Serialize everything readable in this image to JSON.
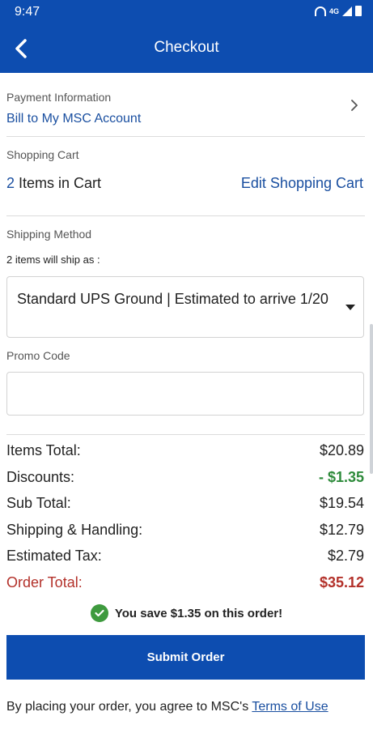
{
  "status_bar": {
    "time": "9:47",
    "network_label": "4G"
  },
  "app_bar": {
    "title": "Checkout"
  },
  "payment": {
    "section_label": "Payment Information",
    "value": "Bill to My MSC Account"
  },
  "cart": {
    "section_label": "Shopping Cart",
    "count": "2",
    "count_suffix": "Items in Cart",
    "edit_label": "Edit Shopping Cart"
  },
  "shipping": {
    "section_label": "Shipping Method",
    "note": "2 items will ship as :",
    "selected_option": "Standard UPS Ground | Estimated to arrive 1/20"
  },
  "promo": {
    "section_label": "Promo Code",
    "value": "",
    "placeholder": ""
  },
  "totals": {
    "items_total_label": "Items Total:",
    "items_total_value": "$20.89",
    "discounts_label": "Discounts:",
    "discounts_value": "- $1.35",
    "sub_total_label": "Sub Total:",
    "sub_total_value": "$19.54",
    "shipping_label": "Shipping & Handling:",
    "shipping_value": "$12.79",
    "tax_label": "Estimated Tax:",
    "tax_value": "$2.79",
    "order_total_label": "Order Total:",
    "order_total_value": "$35.12"
  },
  "savings": {
    "message": "You save $1.35 on this order!"
  },
  "actions": {
    "submit_label": "Submit Order"
  },
  "footer": {
    "agreement_text": "By placing your order, you agree to MSC's ",
    "terms_label": "Terms of Use"
  },
  "colors": {
    "brand_blue": "#0d4db0",
    "link_blue": "#1a4fa0",
    "discount_green": "#2e8b3b",
    "total_red": "#b3312a"
  }
}
